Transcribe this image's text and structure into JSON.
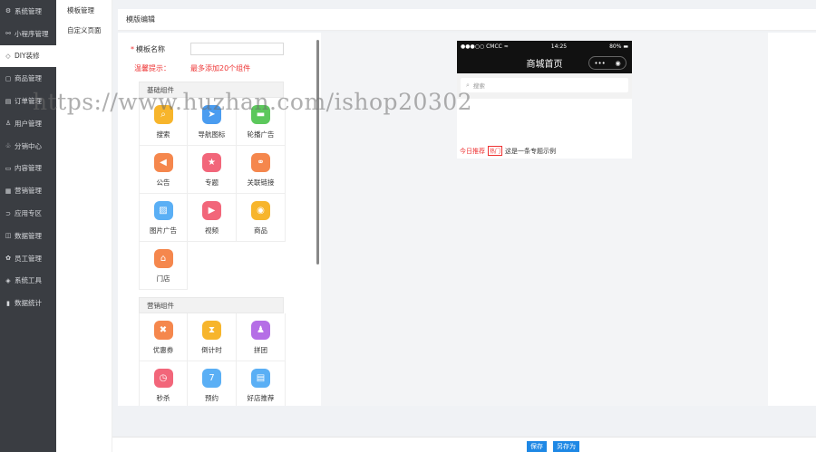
{
  "sidebar": {
    "items": [
      {
        "label": "系统管理",
        "icon": "gear-icon",
        "glyph": "⚙"
      },
      {
        "label": "小程序管理",
        "icon": "link-icon",
        "glyph": "⚯"
      },
      {
        "label": "DIY装修",
        "icon": "diamond-icon",
        "glyph": "◇"
      },
      {
        "label": "商品管理",
        "icon": "box-icon",
        "glyph": "▢"
      },
      {
        "label": "订单管理",
        "icon": "order-icon",
        "glyph": "▤"
      },
      {
        "label": "用户管理",
        "icon": "user-icon",
        "glyph": "♙"
      },
      {
        "label": "分销中心",
        "icon": "network-icon",
        "glyph": "♧"
      },
      {
        "label": "内容管理",
        "icon": "content-icon",
        "glyph": "▭"
      },
      {
        "label": "营销管理",
        "icon": "marketing-icon",
        "glyph": "▦"
      },
      {
        "label": "应用专区",
        "icon": "app-icon",
        "glyph": "⊃"
      },
      {
        "label": "数据管理",
        "icon": "data-icon",
        "glyph": "◫"
      },
      {
        "label": "员工管理",
        "icon": "staff-icon",
        "glyph": "✿"
      },
      {
        "label": "系统工具",
        "icon": "tool-icon",
        "glyph": "◈"
      },
      {
        "label": "数据统计",
        "icon": "stats-icon",
        "glyph": "▮"
      }
    ]
  },
  "submenu": {
    "items": [
      {
        "label": "模板管理"
      },
      {
        "label": "自定义页面"
      }
    ]
  },
  "page": {
    "title": "模版编辑"
  },
  "form": {
    "required_mark": "*",
    "name_label": "模板名称",
    "name_value": "",
    "tip_label": "温馨提示：",
    "tip_text": "最多添加20个组件"
  },
  "basic_group": {
    "title": "基础组件",
    "items": [
      {
        "label": "搜索",
        "icon": "search-icon",
        "glyph": "⌕",
        "color": "#f7b52c"
      },
      {
        "label": "导航图标",
        "icon": "navigation-icon",
        "glyph": "➤",
        "color": "#4a9cf0"
      },
      {
        "label": "轮播广告",
        "icon": "carousel-icon",
        "glyph": "▬",
        "color": "#5cc85c"
      },
      {
        "label": "公告",
        "icon": "notice-icon",
        "glyph": "◀",
        "color": "#f5874d"
      },
      {
        "label": "专题",
        "icon": "topic-icon",
        "glyph": "★",
        "color": "#f2667a"
      },
      {
        "label": "关联链接",
        "icon": "link-icon",
        "glyph": "⚭",
        "color": "#f5874d"
      },
      {
        "label": "图片广告",
        "icon": "image-icon",
        "glyph": "▨",
        "color": "#5aaff5"
      },
      {
        "label": "视频",
        "icon": "video-icon",
        "glyph": "▶",
        "color": "#f2667a"
      },
      {
        "label": "商品",
        "icon": "goods-icon",
        "glyph": "◉",
        "color": "#f7b52c"
      },
      {
        "label": "门店",
        "icon": "store-icon",
        "glyph": "⌂",
        "color": "#f5874d"
      }
    ]
  },
  "marketing_group": {
    "title": "营销组件",
    "items": [
      {
        "label": "优惠券",
        "icon": "coupon-icon",
        "glyph": "✖",
        "color": "#f5874d"
      },
      {
        "label": "倒计时",
        "icon": "hourglass-icon",
        "glyph": "⧗",
        "color": "#f7b52c"
      },
      {
        "label": "拼团",
        "icon": "group-buy-icon",
        "glyph": "♟",
        "color": "#b56ee6"
      },
      {
        "label": "秒杀",
        "icon": "clock-icon",
        "glyph": "◷",
        "color": "#f2667a"
      },
      {
        "label": "预约",
        "icon": "calendar-icon",
        "glyph": "7",
        "color": "#5aaff5"
      },
      {
        "label": "好店推荐",
        "icon": "shop-icon",
        "glyph": "▤",
        "color": "#5aaff5"
      }
    ]
  },
  "phone": {
    "carrier": "●●●○○ CMCC",
    "time": "14:25",
    "battery": "80%",
    "title": "商城首页",
    "search_placeholder": "搜索",
    "notice_label": "今日推荐",
    "notice_tag": "热门",
    "notice_text": "这是一条专题示例"
  },
  "footer": {
    "save_label": "保存",
    "save_as_label": "另存为"
  },
  "watermark": {
    "text": "https://www.huzhan.com/ishop20302"
  }
}
